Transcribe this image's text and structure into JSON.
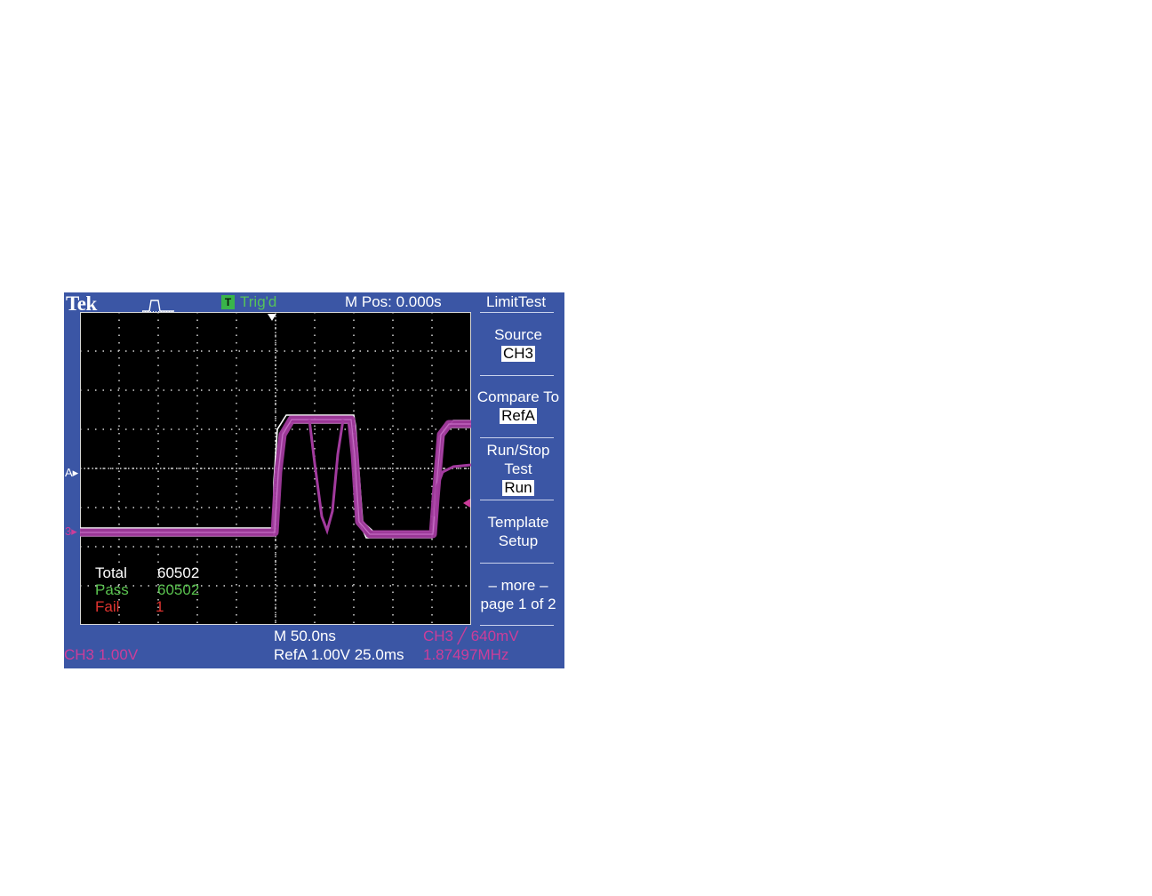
{
  "header": {
    "brand": "Tek",
    "acquire_icon": "pulse-icon",
    "trigger_badge": "T",
    "trigger_status": "Trig'd",
    "main_position": "M Pos: 0.000s"
  },
  "menu": {
    "title": "LimitTest",
    "source": {
      "label": "Source",
      "value": "CH3"
    },
    "compare": {
      "label": "Compare To",
      "value": "RefA"
    },
    "runstop": {
      "label1": "Run/Stop",
      "label2": "Test",
      "value": "Run"
    },
    "template": {
      "label1": "Template",
      "label2": "Setup"
    },
    "more": {
      "label1": "– more –",
      "label2": "page 1 of 2"
    }
  },
  "markers": {
    "ref": "A▸",
    "channel": "3▸"
  },
  "counts": {
    "total_label": "Total",
    "total_value": "60502",
    "pass_label": "Pass",
    "pass_value": "60502",
    "fail_label": "Fail",
    "fail_value": "1"
  },
  "footer": {
    "timebase": "M 50.0ns",
    "ch3_scale": "CH3  1.00V",
    "refa_scale": "RefA 1.00V 25.0ms",
    "trigger_source": "CH3 ╱ 640mV",
    "frequency": "1.87497MHz"
  },
  "colors": {
    "bezel": "#3b56a5",
    "screen": "#000000",
    "trace": "#a23a9e",
    "template": "#ffffff",
    "pass": "#59c24e",
    "fail": "#e0332f",
    "channel": "#cc3d9a"
  }
}
